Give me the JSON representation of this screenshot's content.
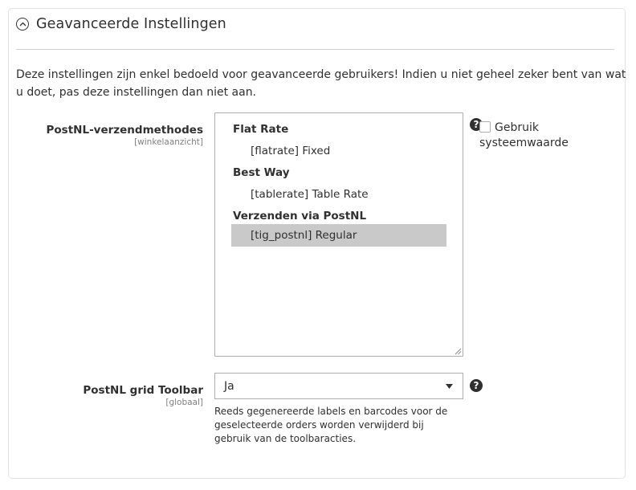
{
  "section": {
    "title": "Geavanceerde Instellingen",
    "description": "Deze instellingen zijn enkel bedoeld voor geavanceerde gebruikers! Indien u niet geheel zeker bent van wat u doet, pas deze instellingen dan niet aan."
  },
  "shipping_methods": {
    "label": "PostNL-verzendmethodes",
    "scope": "[winkelaanzicht]",
    "groups": [
      {
        "label": "Flat Rate",
        "options": [
          {
            "label": "[flatrate] Fixed",
            "selected": false
          }
        ]
      },
      {
        "label": "Best Way",
        "options": [
          {
            "label": "[tablerate] Table Rate",
            "selected": false
          }
        ]
      },
      {
        "label": "Verzenden via PostNL",
        "options": [
          {
            "label": "[tig_postnl] Regular",
            "selected": true
          }
        ]
      }
    ],
    "use_system_value_label": "Gebruik systeemwaarde",
    "use_system_value_checked": false
  },
  "grid_toolbar": {
    "label": "PostNL grid Toolbar",
    "scope": "[globaal]",
    "value": "Ja",
    "note": "Reeds gegenereerde labels en barcodes voor de geselecteerde orders worden verwijderd bij gebruik van de toolbaracties."
  },
  "icons": {
    "collapse": "chevron-up-circle-icon",
    "help": "question-mark-icon",
    "dropdown": "caret-down-icon"
  },
  "colors": {
    "selected_option_bg": "#c9c9c9",
    "border": "#adadad",
    "help_icon": "#303030"
  }
}
